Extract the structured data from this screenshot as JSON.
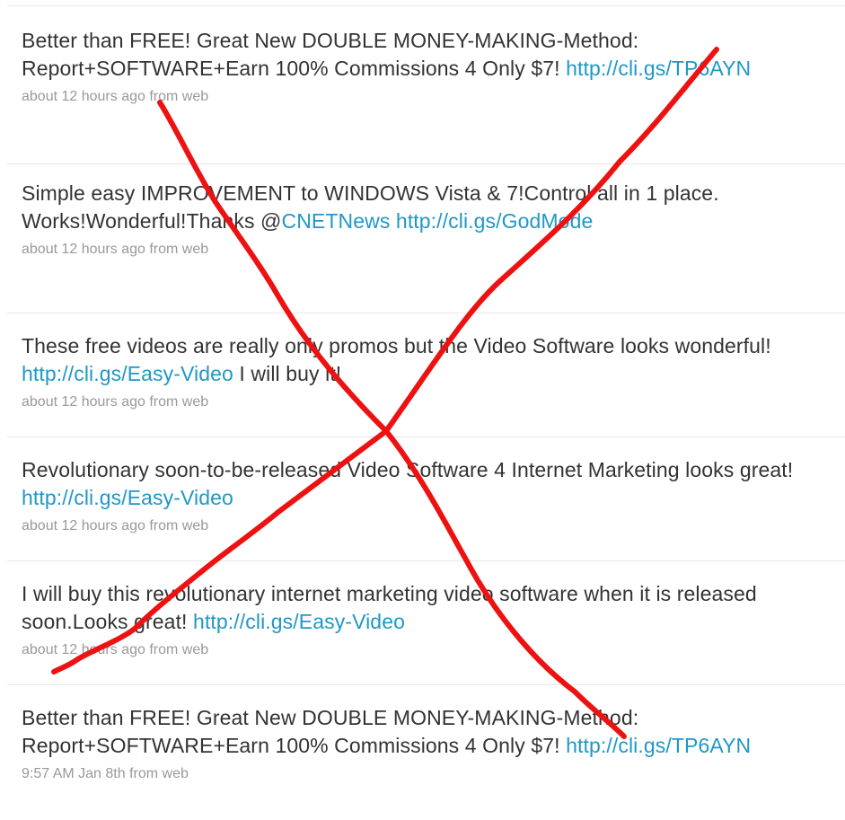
{
  "timeline": {
    "tweets": [
      {
        "text_before": "Better than FREE! Great New DOUBLE MONEY-MAKING-Method: Report+SOFTWARE+Earn 100% Commissions 4 Only $7!",
        "mention": "",
        "between": " ",
        "link": "http://cli.gs/TP6AYN",
        "text_after": "",
        "meta": "about 12 hours ago from web"
      },
      {
        "text_before": "Simple easy IMPROVEMENT to WINDOWS Vista & 7!Control all in 1 place. Works!Wonderful!Thanks @",
        "mention": "CNETNews",
        "between": " ",
        "link": "http://cli.gs/GodMode",
        "text_after": "",
        "meta": "about 12 hours ago from web"
      },
      {
        "text_before": "These free videos are really only promos but the Video Software looks wonderful! ",
        "mention": "",
        "between": "",
        "link": "http://cli.gs/Easy-Video",
        "text_after": " I will buy it!",
        "meta": "about 12 hours ago from web"
      },
      {
        "text_before": "Revolutionary soon-to-be-released Video Software 4 Internet Marketing looks great! ",
        "mention": "",
        "between": "",
        "link": "http://cli.gs/Easy-Video",
        "text_after": "",
        "meta": "about 12 hours ago from web"
      },
      {
        "text_before": "I will buy this revolutionary internet marketing video software when it is released soon.Looks great! ",
        "mention": "",
        "between": "",
        "link": "http://cli.gs/Easy-Video",
        "text_after": "",
        "meta": "about 12 hours ago from web"
      },
      {
        "text_before": "Better than FREE! Great New DOUBLE MONEY-MAKING-Method: Report+SOFTWARE+Earn 100% Commissions 4 Only $7!",
        "mention": "",
        "between": " ",
        "link": "http://cli.gs/TP6AYN",
        "text_after": "",
        "meta": "9:57 AM Jan 8th from web"
      }
    ]
  },
  "colors": {
    "link": "#1f98c7",
    "text": "#333333",
    "meta": "#999999",
    "divider": "#e6e6e6",
    "cross_annotation": "#ee1111"
  }
}
